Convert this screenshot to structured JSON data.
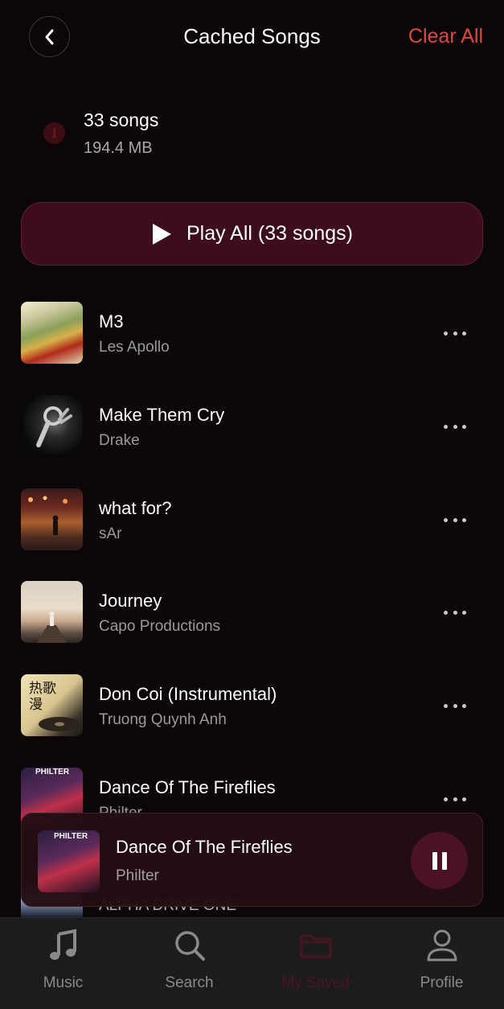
{
  "header": {
    "title": "Cached Songs",
    "clear_label": "Clear All"
  },
  "summary": {
    "count_text": "33 songs",
    "size_text": "194.4 MB"
  },
  "play_all": {
    "label": "Play All (33 songs)"
  },
  "songs": [
    {
      "title": "M3",
      "artist": "Les Apollo"
    },
    {
      "title": "Make Them Cry",
      "artist": "Drake"
    },
    {
      "title": "what for?",
      "artist": "sAr"
    },
    {
      "title": "Journey",
      "artist": "Capo Productions"
    },
    {
      "title": "Don Coi (Instrumental)",
      "artist": "Truong Quynh Anh"
    },
    {
      "title": "Dance Of The Fireflies",
      "artist": "Philter"
    }
  ],
  "cover_labels": {
    "don_coi": "热歌\n漫",
    "philter": "PHILTER"
  },
  "peek": {
    "artist": "ALPHA DRIVE ONE"
  },
  "now_playing": {
    "title": "Dance Of The Fireflies",
    "artist": "Philter",
    "state": "playing"
  },
  "tabs": [
    {
      "label": "Music",
      "icon": "music-note-icon"
    },
    {
      "label": "Search",
      "icon": "search-icon"
    },
    {
      "label": "My Saved",
      "icon": "folder-icon"
    },
    {
      "label": "Profile",
      "icon": "person-icon"
    }
  ],
  "colors": {
    "accent": "#e5453f",
    "play_button_bg": "#3d0d1d",
    "active_tab": "#4a1420",
    "background": "#0b0607"
  }
}
